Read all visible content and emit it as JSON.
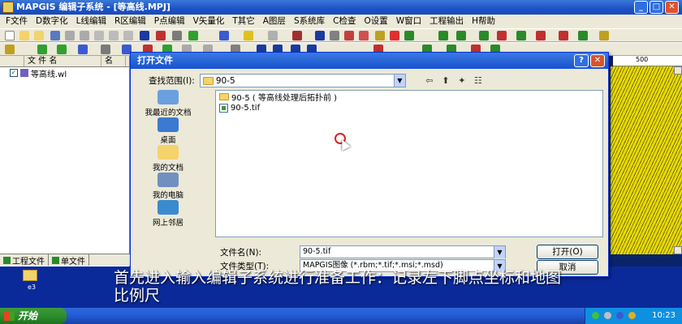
{
  "app": {
    "title": "MAPGIS 编辑子系统 - [等高线.MPJ]"
  },
  "menu": [
    "F文件",
    "D数字化",
    "L线编辑",
    "R区编辑",
    "P点编辑",
    "V矢量化",
    "T其它",
    "A图层",
    "S系统库",
    "C检查",
    "O设置",
    "W窗口",
    "工程输出",
    "H帮助"
  ],
  "left_panel": {
    "columns": [
      "文 件 名",
      "名"
    ],
    "files": [
      {
        "name": "等高线.wl"
      }
    ],
    "tabs": [
      "工程文件",
      "单文件"
    ]
  },
  "ruler": {
    "label": "500"
  },
  "dialog": {
    "title": "打开文件",
    "look_in_label": "查找范围(I):",
    "look_in_value": "90-5",
    "places": [
      "我最近的文档",
      "桌面",
      "我的文档",
      "我的电脑",
      "网上邻居"
    ],
    "files": [
      {
        "name": "90-5 ( 等高线处理后拓扑前 )",
        "type": "folder"
      },
      {
        "name": "90-5.tif",
        "type": "image"
      }
    ],
    "filename_label": "文件名(N):",
    "filename_value": "90-5.tif",
    "filetype_label": "文件类型(T):",
    "filetype_value": "MAPGIS图像 (*.rbm;*.tif;*.msi;*.msd)",
    "open_button": "打开(O)",
    "cancel_button": "取消"
  },
  "desktop": {
    "icon_label": "e3"
  },
  "taskbar": {
    "start": "开始",
    "clock": "10:23"
  },
  "subtitle": "首先进入输入编辑子系统进行准备工作：记录左下脚点坐标和地图比例尺"
}
